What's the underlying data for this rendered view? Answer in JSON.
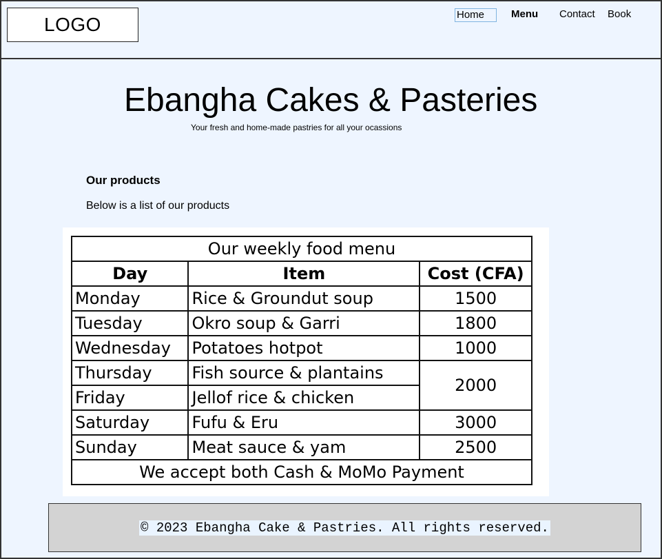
{
  "header": {
    "logo": "LOGO",
    "nav": {
      "home": "Home",
      "menu": "Menu",
      "contact": "Contact",
      "book": "Book"
    }
  },
  "hero": {
    "title": "Ebangha Cakes & Pasteries",
    "tagline": "Your fresh and home-made pastries for all your ocassions"
  },
  "products": {
    "heading": "Our products",
    "intro": "Below is a list of our products"
  },
  "menu_table": {
    "title": "Our weekly food menu",
    "headers": [
      "Day",
      "Item",
      "Cost (CFA)"
    ],
    "rows": [
      {
        "day": "Monday",
        "item": "Rice & Groundut soup",
        "cost": "1500"
      },
      {
        "day": "Tuesday",
        "item": "Okro soup & Garri",
        "cost": "1800"
      },
      {
        "day": "Wednesday",
        "item": "Potatoes hotpot",
        "cost": "1000"
      },
      {
        "day": "Thursday",
        "item": "Fish source & plantains",
        "cost": "2000"
      },
      {
        "day": "Friday",
        "item": "Jellof rice & chicken",
        "cost": "2000"
      },
      {
        "day": "Saturday",
        "item": "Fufu & Eru",
        "cost": "3000"
      },
      {
        "day": "Sunday",
        "item": "Meat sauce & yam",
        "cost": "2500"
      }
    ],
    "footer_note": "We accept both Cash & MoMo Payment"
  },
  "footer": {
    "copyright": "© 2023 Ebangha Cake & Pastries. All rights reserved."
  }
}
